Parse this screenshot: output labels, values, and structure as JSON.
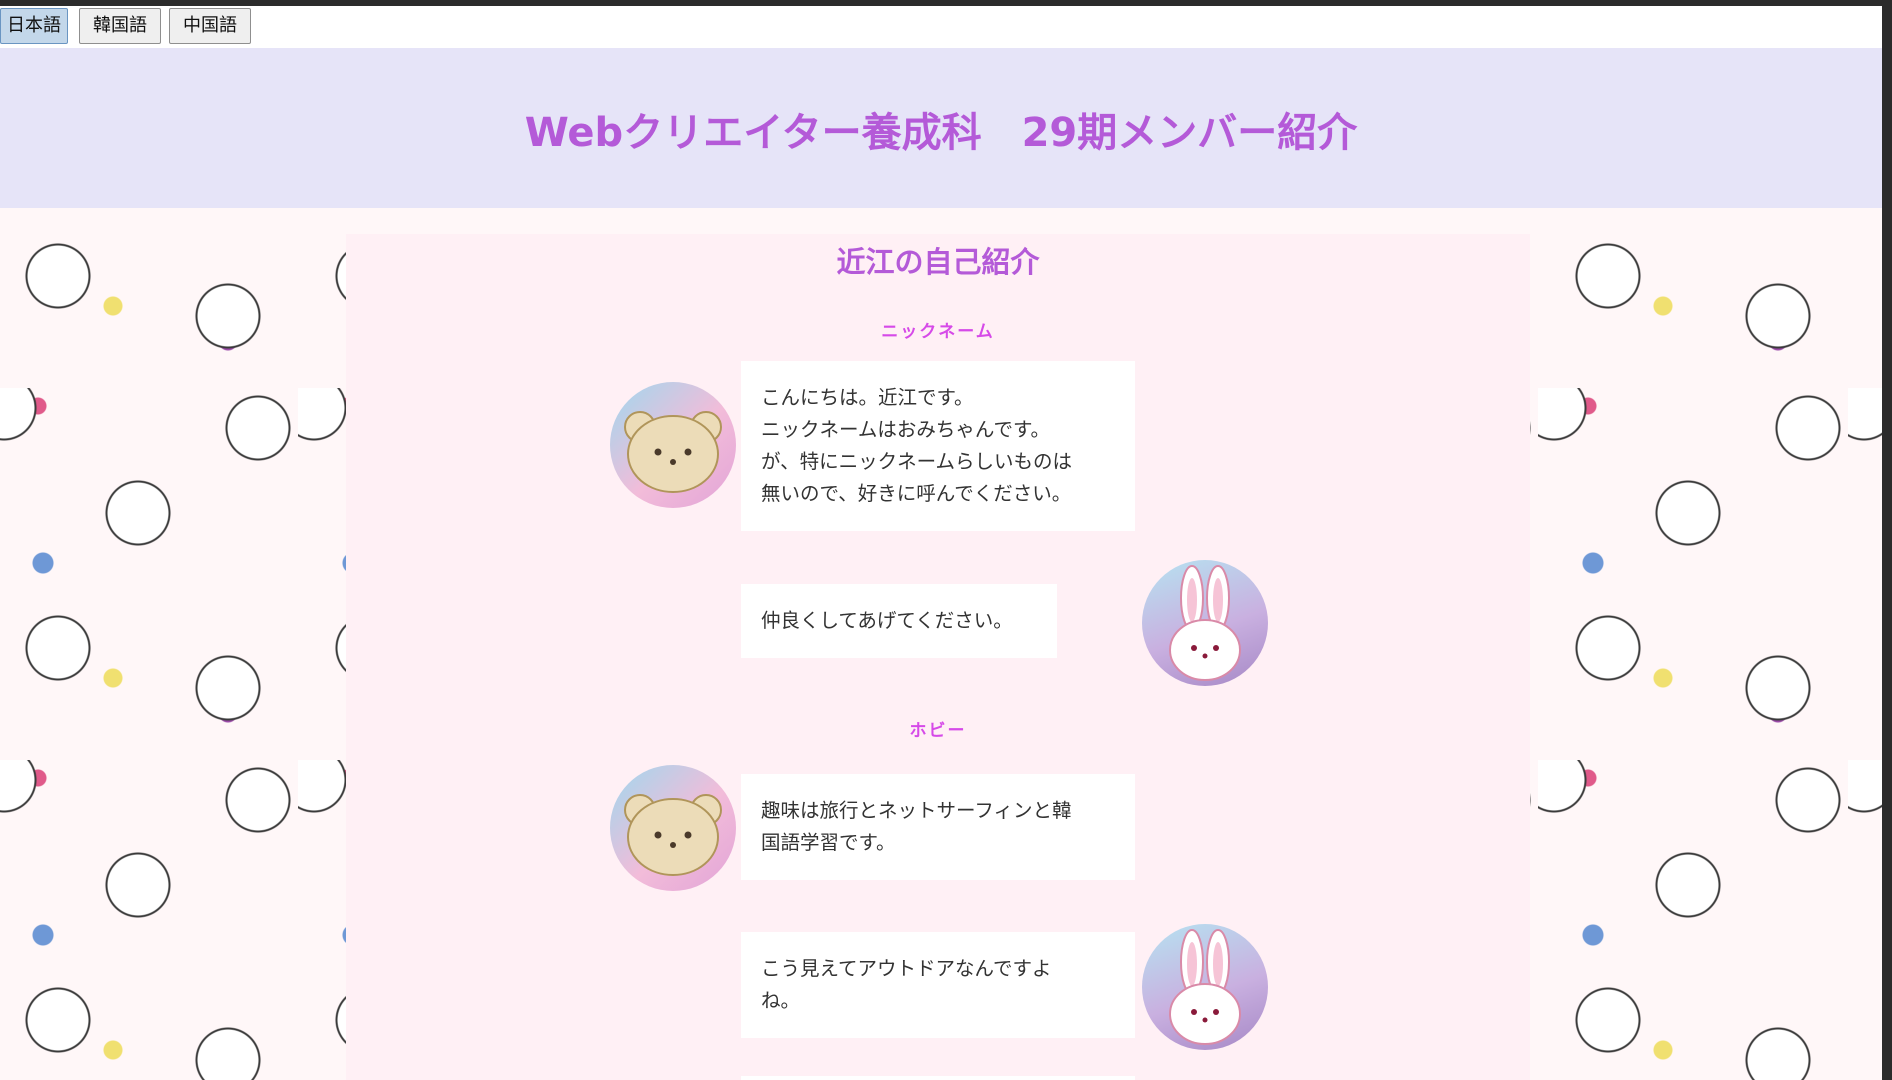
{
  "lang_menu": {
    "items": [
      {
        "label": "日本語",
        "active": true
      },
      {
        "label": "韓国語",
        "active": false
      },
      {
        "label": "中国語",
        "active": false
      }
    ]
  },
  "header": {
    "title": "Webクリエイター養成科　29期メンバー紹介"
  },
  "intro": {
    "title": "近江の自己紹介",
    "sections": [
      {
        "heading": "ニックネーム",
        "messages": [
          {
            "speaker": "bear",
            "lines": [
              "こんにちは。近江です。",
              "ニックネームはおみちゃんです。",
              "が、特にニックネームらしいものは",
              "無いので、好きに呼んでください。"
            ]
          },
          {
            "speaker": "bunny",
            "lines": [
              "仲良くしてあげてください。"
            ]
          }
        ]
      },
      {
        "heading": "ホビー",
        "messages": [
          {
            "speaker": "bear",
            "lines": [
              "趣味は旅行とネットサーフィンと韓",
              "国語学習です。"
            ]
          },
          {
            "speaker": "bunny",
            "lines": [
              "こう見えてアウトドアなんですよ",
              "ね。"
            ]
          }
        ]
      }
    ]
  },
  "colors": {
    "accent_purple": "#b45ad8",
    "heading_magenta": "#d64ae8",
    "header_bg": "#e6e4f8",
    "panel_bg": "#fff0f5"
  },
  "icons": {
    "bear_avatar": "bear-avatar-icon",
    "bunny_avatar": "bunny-avatar-icon"
  }
}
